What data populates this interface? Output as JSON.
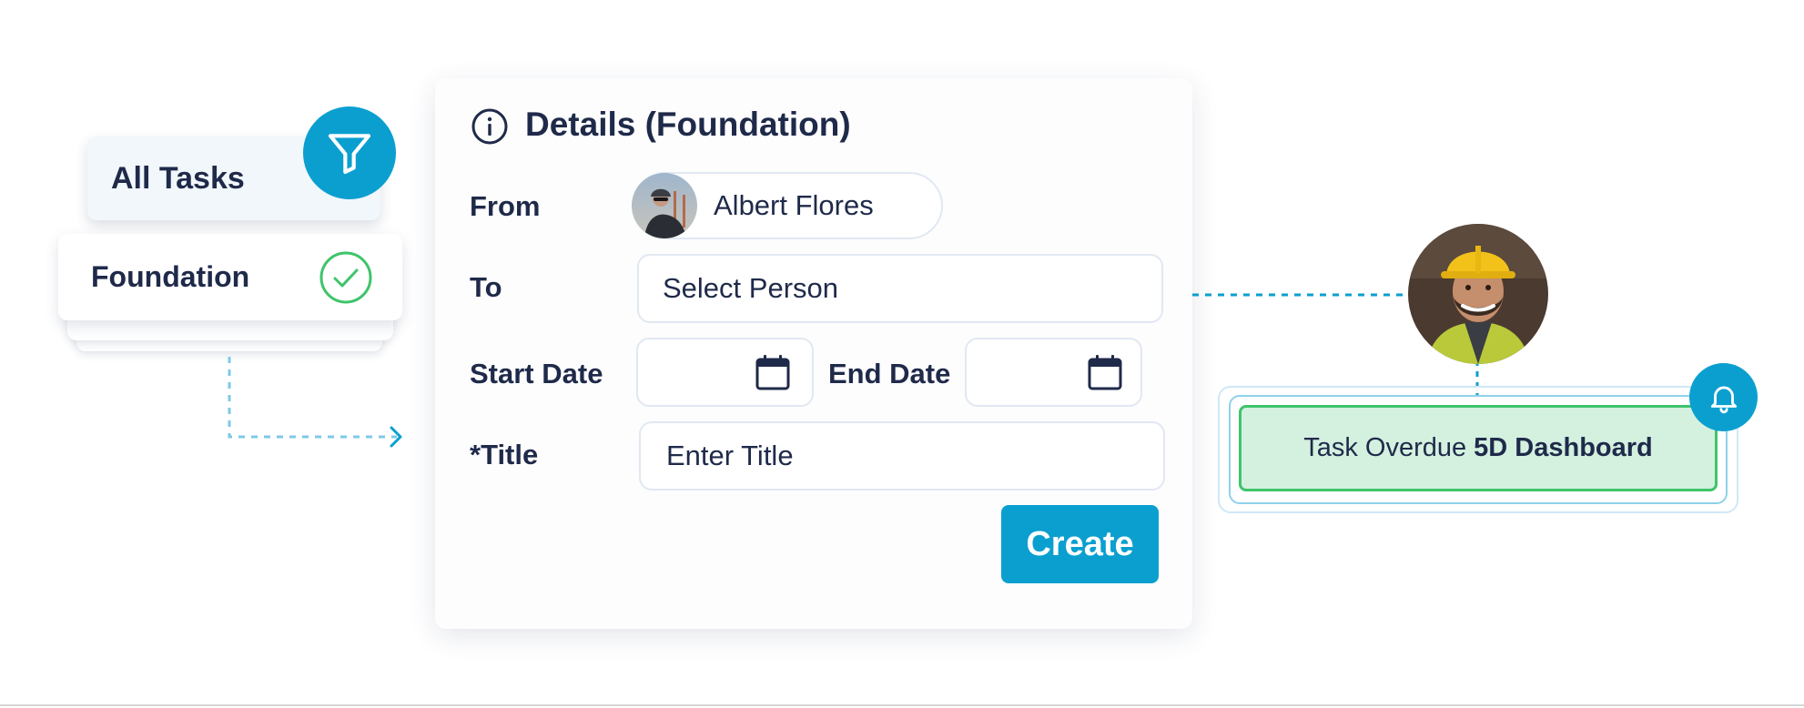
{
  "colors": {
    "accent": "#0b9fd0",
    "text": "#1f2a4a",
    "success": "#3ec46b",
    "notification_bg": "#d4f0df"
  },
  "left": {
    "all_tasks_label": "All Tasks",
    "filter_icon": "filter-icon",
    "foundation_label": "Foundation",
    "check_icon": "check-circle-icon"
  },
  "panel": {
    "title": "Details (Foundation)",
    "info_icon": "info-icon",
    "from_label": "From",
    "from_person": "Albert Flores",
    "to_label": "To",
    "to_placeholder": "Select Person",
    "start_date_label": "Start Date",
    "end_date_label": "End Date",
    "calendar_icon": "calendar-icon",
    "title_label": "*Title",
    "title_placeholder": "Enter Title",
    "create_label": "Create"
  },
  "notification": {
    "prefix": "Task Overdue",
    "emphasis": "5D Dashboard",
    "bell_icon": "bell-icon"
  }
}
